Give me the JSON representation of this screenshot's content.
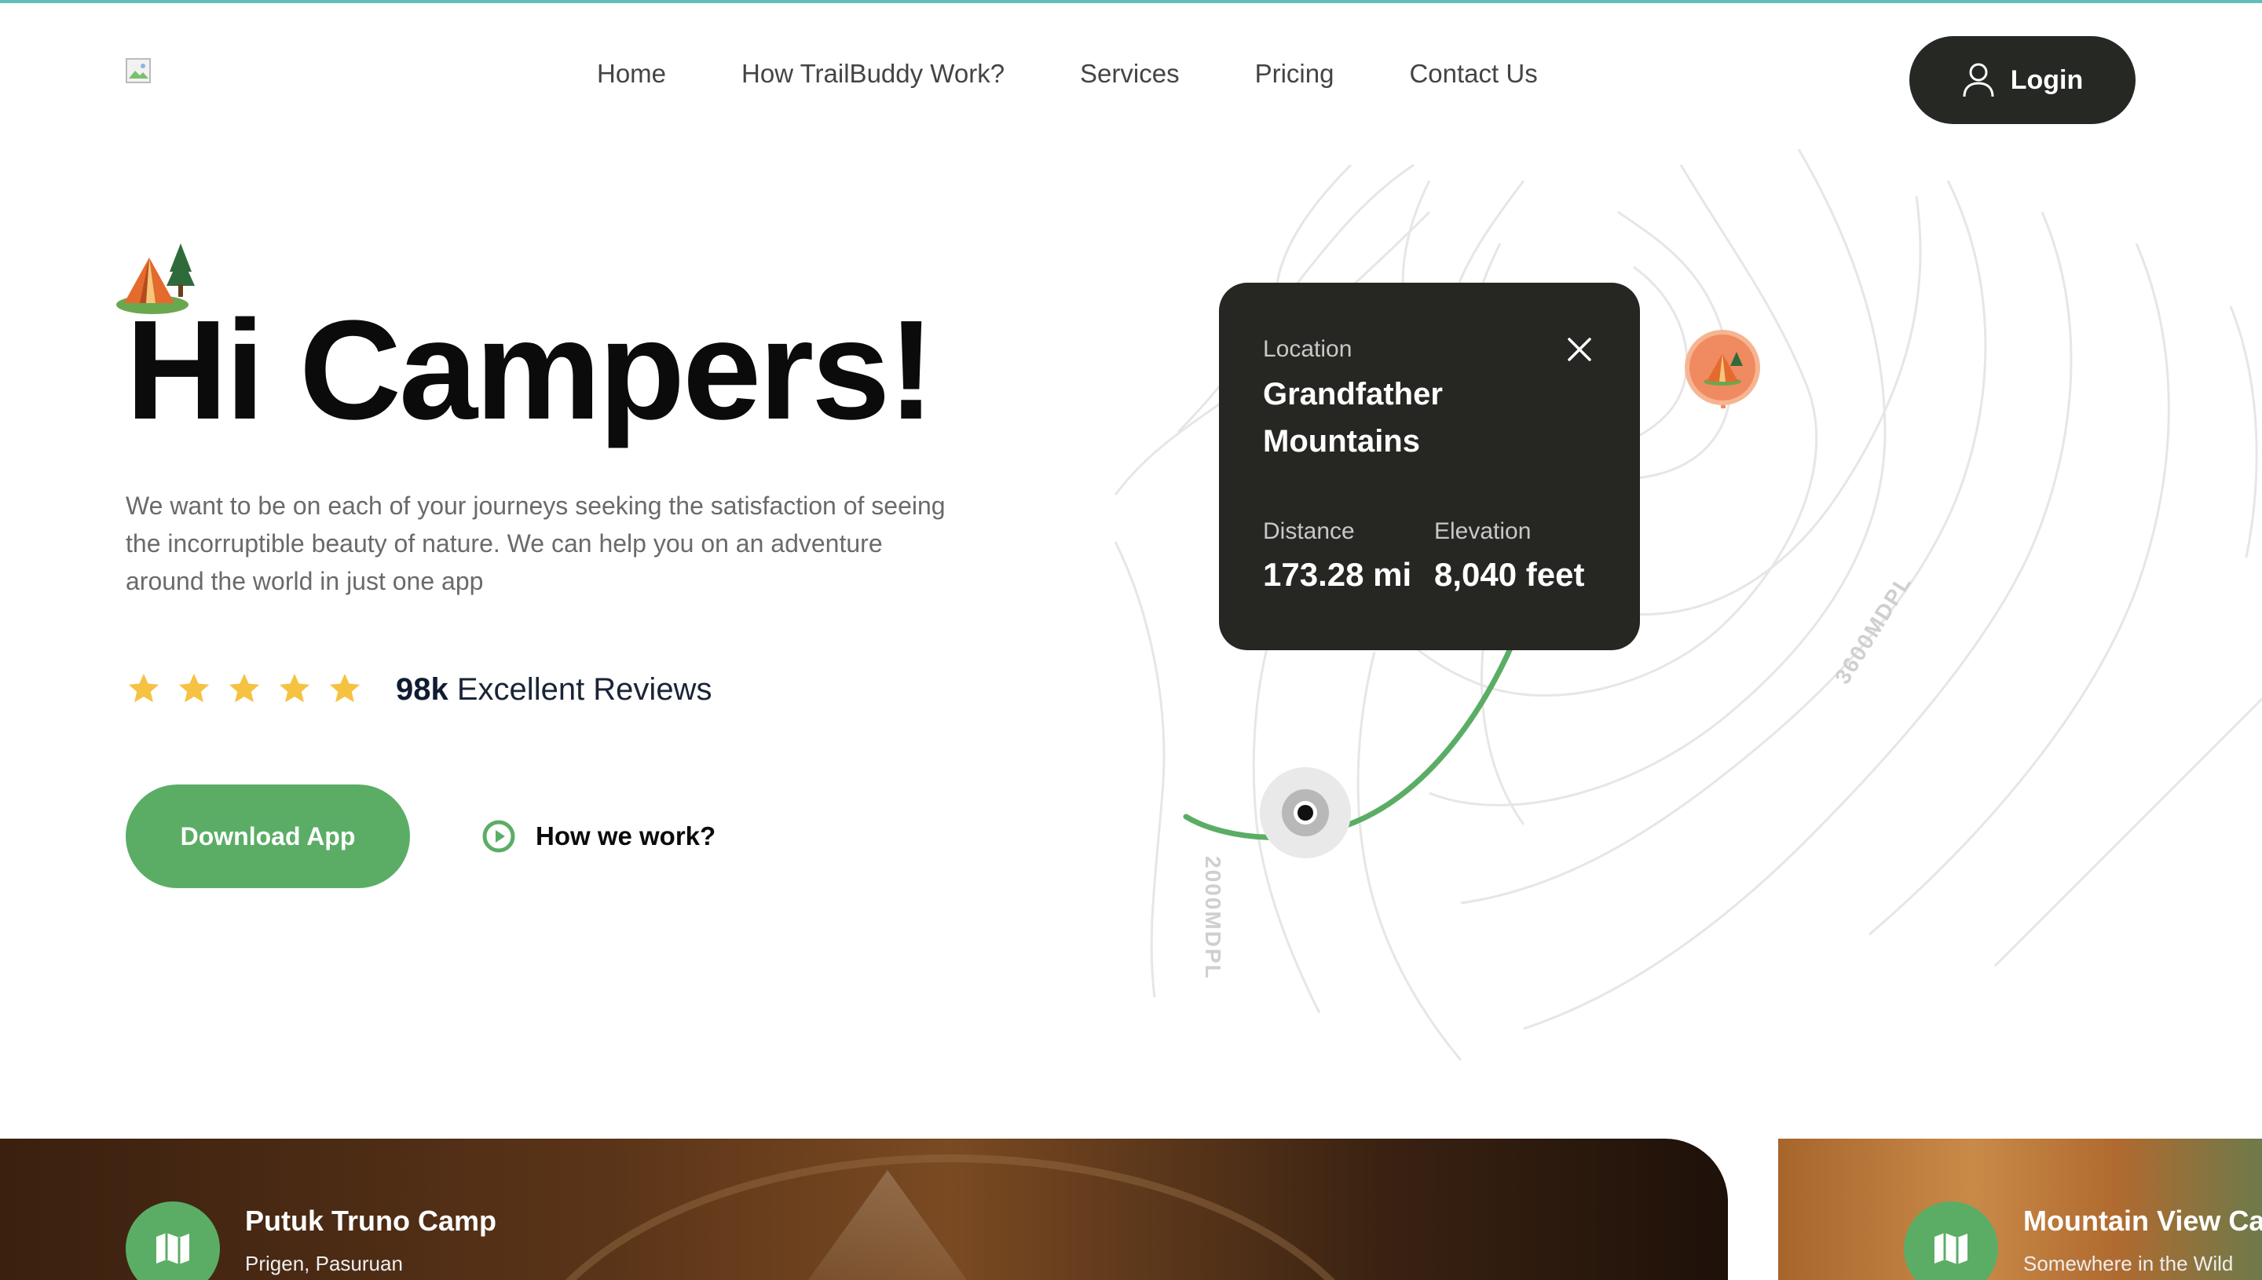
{
  "header": {
    "nav": [
      "Home",
      "How TrailBuddy Work?",
      "Services",
      "Pricing",
      "Contact Us"
    ],
    "login_label": "Login"
  },
  "hero": {
    "title": "Hi Campers!",
    "description": "We want to be on each of your journeys seeking the satisfaction of seeing the incorruptible beauty of nature. We can help you on an adventure around the world in just one app",
    "rating_stars": 5,
    "reviews_count": "98k",
    "reviews_label": "Excellent Reviews",
    "download_label": "Download App",
    "how_label": "How we work?"
  },
  "location_card": {
    "location_label": "Location",
    "location_value": "Grandfather Mountains",
    "distance_label": "Distance",
    "distance_value": "173.28 mi",
    "elevation_label": "Elevation",
    "elevation_value": "8,040 feet"
  },
  "map": {
    "contour_labels": [
      "2000MDPL",
      "3600MDPL"
    ],
    "route_color": "#5bad66",
    "destination_pin_color": "#f08a60"
  },
  "camps": [
    {
      "title": "Putuk Truno Camp",
      "subtitle": "Prigen, Pasuruan"
    },
    {
      "title": "Mountain View Ca",
      "subtitle": "Somewhere in the Wild"
    }
  ],
  "colors": {
    "accent_green": "#5bad66",
    "dark": "#262824",
    "star": "#f5c242",
    "top_line": "#5fbfb6"
  }
}
